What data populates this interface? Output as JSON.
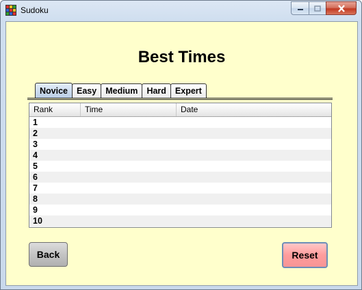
{
  "window": {
    "title": "Sudoku"
  },
  "page": {
    "heading": "Best Times"
  },
  "tabs": [
    {
      "label": "Novice",
      "active": true
    },
    {
      "label": "Easy",
      "active": false
    },
    {
      "label": "Medium",
      "active": false
    },
    {
      "label": "Hard",
      "active": false
    },
    {
      "label": "Expert",
      "active": false
    }
  ],
  "table": {
    "columns": [
      "Rank",
      "Time",
      "Date"
    ],
    "rows": [
      {
        "rank": "1",
        "time": "",
        "date": ""
      },
      {
        "rank": "2",
        "time": "",
        "date": ""
      },
      {
        "rank": "3",
        "time": "",
        "date": ""
      },
      {
        "rank": "4",
        "time": "",
        "date": ""
      },
      {
        "rank": "5",
        "time": "",
        "date": ""
      },
      {
        "rank": "6",
        "time": "",
        "date": ""
      },
      {
        "rank": "7",
        "time": "",
        "date": ""
      },
      {
        "rank": "8",
        "time": "",
        "date": ""
      },
      {
        "rank": "9",
        "time": "",
        "date": ""
      },
      {
        "rank": "10",
        "time": "",
        "date": ""
      }
    ]
  },
  "buttons": {
    "back": "Back",
    "reset": "Reset"
  },
  "colors": {
    "client_bg": "#ffffcc",
    "reset_bg": "#ff9c9c"
  },
  "icons": [
    "sudoku-app-icon",
    "minimize-icon",
    "maximize-icon",
    "close-icon"
  ]
}
